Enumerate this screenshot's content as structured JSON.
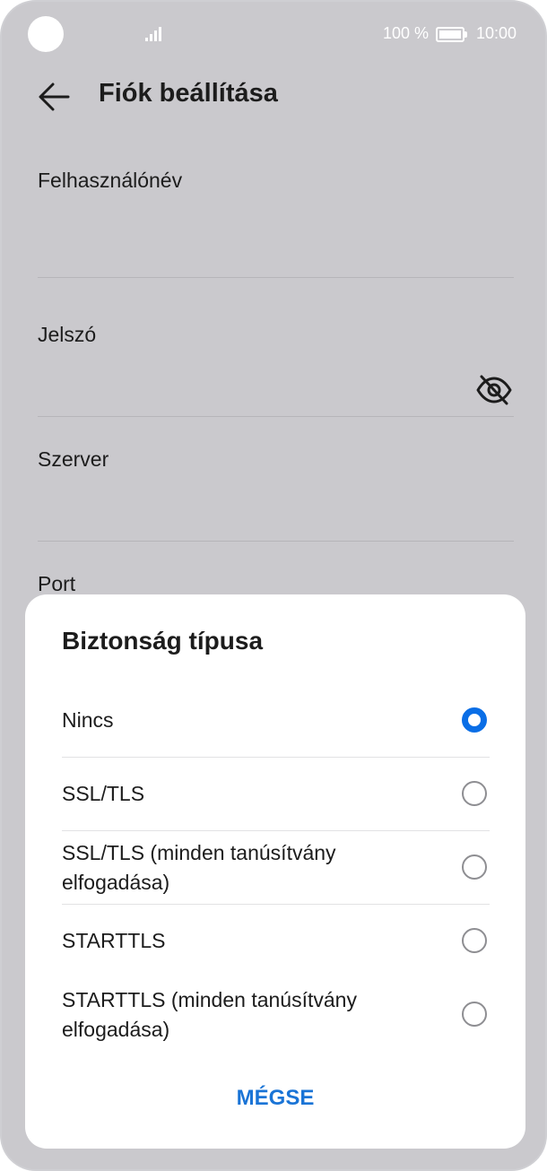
{
  "status_bar": {
    "battery_percent": "100 %",
    "time": "10:00"
  },
  "header": {
    "title": "Fiók beállítása"
  },
  "form": {
    "username_label": "Felhasználónév",
    "password_label": "Jelszó",
    "server_label": "Szerver",
    "port_label": "Port"
  },
  "dialog": {
    "title": "Biztonság típusa",
    "options": [
      {
        "label": "Nincs",
        "selected": true
      },
      {
        "label": "SSL/TLS",
        "selected": false
      },
      {
        "label": "SSL/TLS (minden tanúsítvány elfogadása)",
        "selected": false
      },
      {
        "label": "STARTTLS",
        "selected": false
      },
      {
        "label": "STARTTLS (minden tanúsítvány elfogadása)",
        "selected": false
      }
    ],
    "cancel_label": "MÉGSE"
  },
  "icons": {
    "back": "arrow-left-icon",
    "password_visibility": "eye-off-icon",
    "signal": "signal-icon",
    "battery": "battery-icon"
  },
  "colors": {
    "accent": "#0a6ee6",
    "cancel_text": "#1a74d6",
    "scrim_background": "#cac9cd"
  }
}
